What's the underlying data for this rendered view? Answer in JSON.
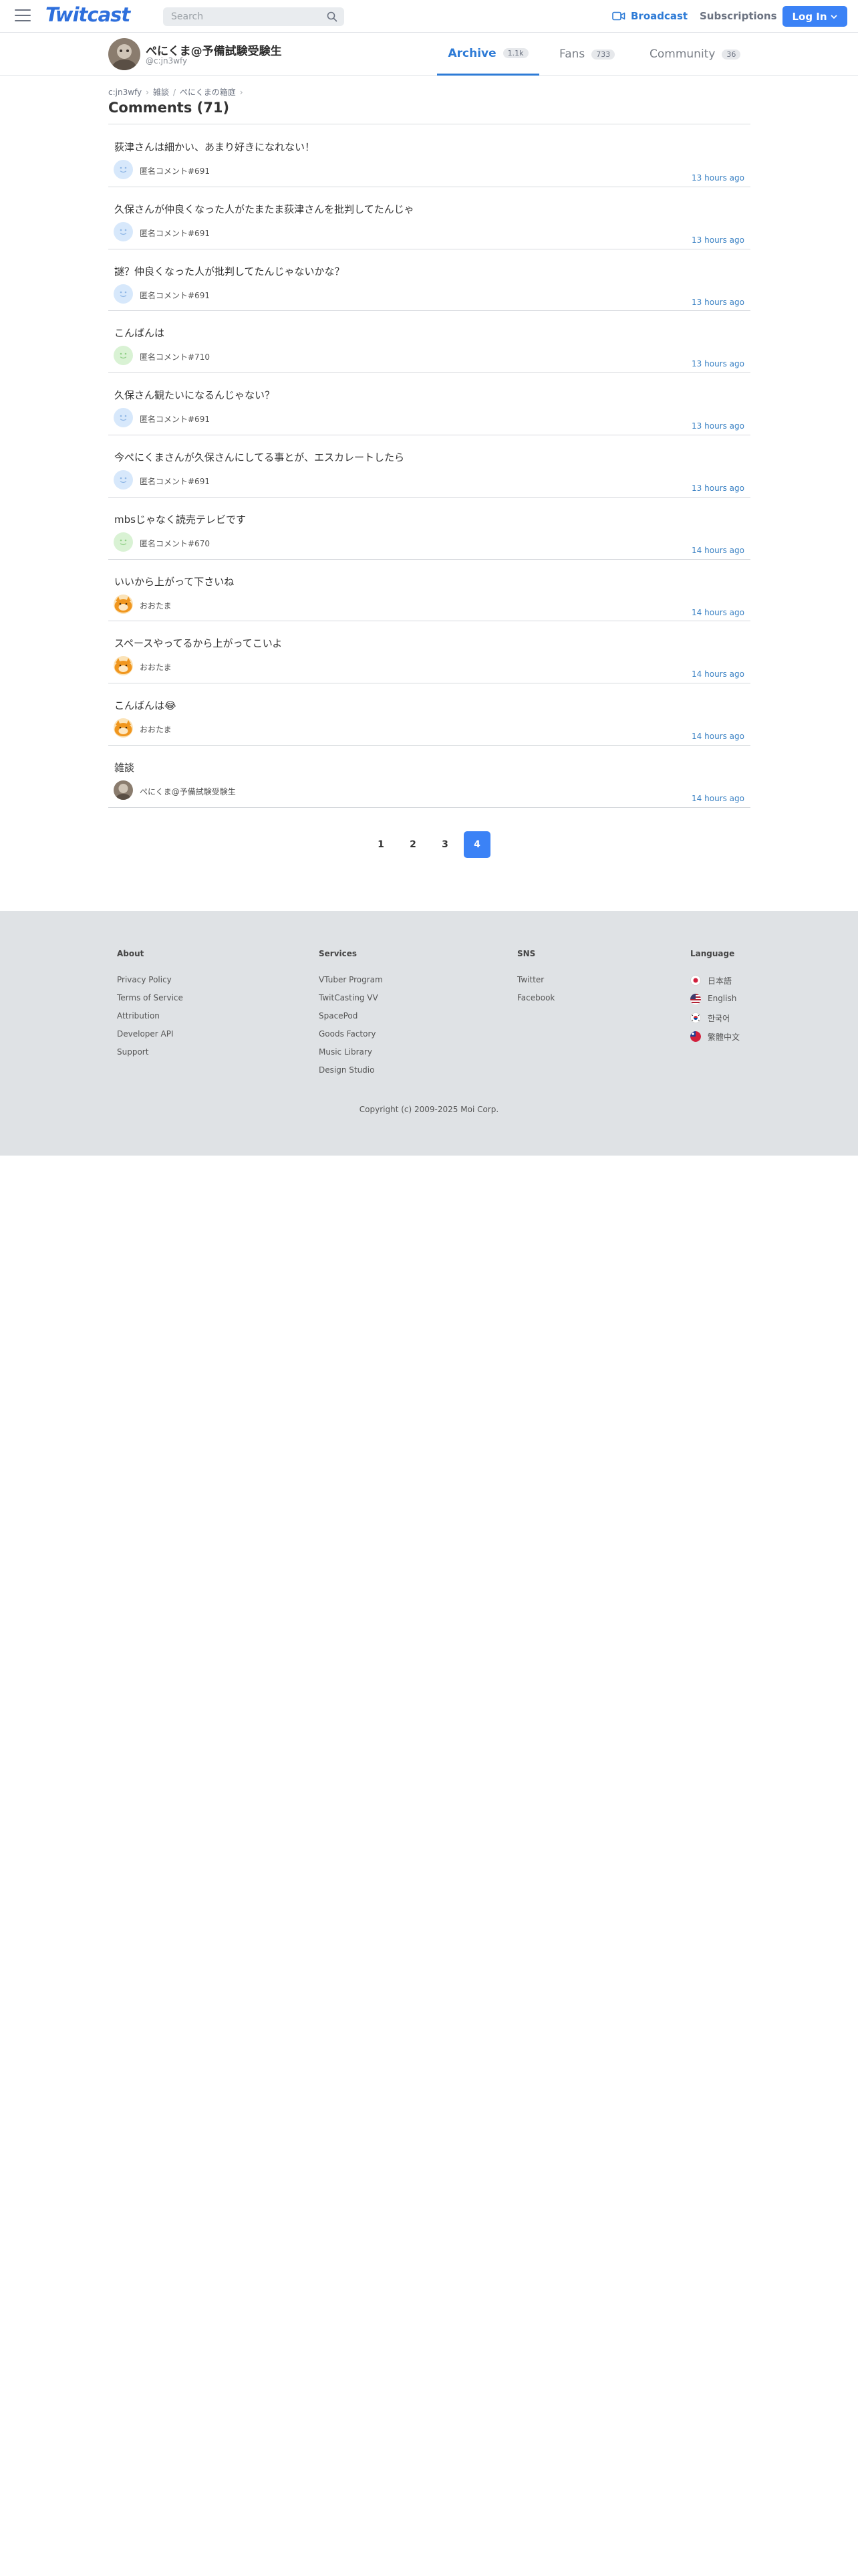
{
  "header": {
    "logo": "Twitcast",
    "search_placeholder": "Search",
    "broadcast_label": "Broadcast",
    "subscriptions_label": "Subscriptions",
    "login_label": "Log In",
    "accent_color": "#3b82f6"
  },
  "profile": {
    "name": "ぺにくま@予備試験受験生",
    "id": "@c:jn3wfy",
    "tabs": [
      {
        "label": "Archive",
        "count": "1.1k"
      },
      {
        "label": "Fans",
        "count": "733"
      },
      {
        "label": "Community",
        "count": "36"
      }
    ]
  },
  "breadcrumb": [
    "c:jn3wfy",
    "雑談",
    "ぺにくまの箱庭"
  ],
  "page_title": "Comments (71)",
  "comments": [
    {
      "text": "荻津さんは細かい、あまり好きになれない！",
      "author": "匿名コメント#691",
      "time": "13 hours ago",
      "avatar": "anon-blue"
    },
    {
      "text": "久保さんが仲良くなった人がたまたま荻津さんを批判してたんじゃ",
      "author": "匿名コメント#691",
      "time": "13 hours ago",
      "avatar": "anon-blue"
    },
    {
      "text": "謎？仲良くなった人が批判してたんじゃないかな？",
      "author": "匿名コメント#691",
      "time": "13 hours ago",
      "avatar": "anon-blue"
    },
    {
      "text": "こんばんは",
      "author": "匿名コメント#710",
      "time": "13 hours ago",
      "avatar": "anon-green"
    },
    {
      "text": "久保さん観たいになるんじゃない？",
      "author": "匿名コメント#691",
      "time": "13 hours ago",
      "avatar": "anon-blue"
    },
    {
      "text": "今ぺにくまさんが久保さんにしてる事とが、エスカレートしたら",
      "author": "匿名コメント#691",
      "time": "13 hours ago",
      "avatar": "anon-blue"
    },
    {
      "text": "mbsじゃなく読売テレビです",
      "author": "匿名コメント#670",
      "time": "14 hours ago",
      "avatar": "anon-green"
    },
    {
      "text": "いいから上がって下さいね",
      "author": "おおたま",
      "time": "14 hours ago",
      "avatar": "orange-cat"
    },
    {
      "text": "スペースやってるから上がってこいよ",
      "author": "おおたま",
      "time": "14 hours ago",
      "avatar": "orange-cat"
    },
    {
      "text": "こんばんは😂",
      "author": "おおたま",
      "time": "14 hours ago",
      "avatar": "orange-cat"
    },
    {
      "text": "雑談",
      "author": "ぺにくま@予備試験受験生",
      "time": "14 hours ago",
      "avatar": "photo"
    }
  ],
  "pagination": {
    "pages": [
      "1",
      "2",
      "3",
      "4"
    ],
    "current": "4"
  },
  "footer": {
    "about": {
      "title": "About",
      "links": [
        "Privacy Policy",
        "Terms of Service",
        "Attribution",
        "Developer API",
        "Support"
      ]
    },
    "services": {
      "title": "Services",
      "links": [
        "VTuber Program",
        "TwitCasting VV",
        "SpacePod",
        "Goods Factory",
        "Music Library",
        "Design Studio"
      ]
    },
    "sns": {
      "title": "SNS",
      "links": [
        "Twitter",
        "Facebook"
      ]
    },
    "language": {
      "title": "Language",
      "links": [
        "日本語",
        "English",
        "한국어",
        "繁體中文"
      ]
    },
    "copyright": "Copyright (c) 2009-2025 Moi Corp."
  }
}
